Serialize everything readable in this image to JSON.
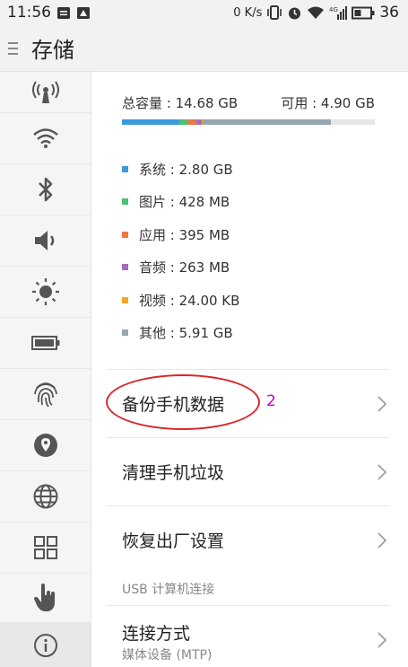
{
  "status_bar": {
    "time": "11:56",
    "network_speed": "0 K/s",
    "signal_label": "4G",
    "battery": "36"
  },
  "header": {
    "title": "存储"
  },
  "sidebar": {
    "items": [
      {
        "icon": "hotspot-icon"
      },
      {
        "icon": "wifi-icon"
      },
      {
        "icon": "bluetooth-icon"
      },
      {
        "icon": "volume-icon"
      },
      {
        "icon": "brightness-icon"
      },
      {
        "icon": "battery-icon"
      },
      {
        "icon": "fingerprint-icon"
      },
      {
        "icon": "location-icon"
      },
      {
        "icon": "globe-icon"
      },
      {
        "icon": "apps-grid-icon"
      },
      {
        "icon": "touch-hand-icon"
      },
      {
        "icon": "info-icon"
      }
    ],
    "selected": "info-icon"
  },
  "storage": {
    "total_label": "总容量 : 14.68 GB",
    "available_label": "可用 : 4.90 GB",
    "segments": [
      {
        "name": "系统",
        "value": "2.80 GB",
        "label": "系统 : 2.80 GB",
        "color": "#3b9ad9",
        "fraction": 0.227
      },
      {
        "name": "图片",
        "value": "428 MB",
        "label": "图片 : 428 MB",
        "color": "#4cc173",
        "fraction": 0.035
      },
      {
        "name": "应用",
        "value": "395 MB",
        "label": "应用 : 395 MB",
        "color": "#f0763f",
        "fraction": 0.032
      },
      {
        "name": "音频",
        "value": "263 MB",
        "label": "音频 : 263 MB",
        "color": "#a66bbf",
        "fraction": 0.021
      },
      {
        "name": "视频",
        "value": "24.00 KB",
        "label": "视频 : 24.00 KB",
        "color": "#f2a922",
        "fraction": 0.004
      },
      {
        "name": "其他",
        "value": "5.91 GB",
        "label": "其他 : 5.91 GB",
        "color": "#95a7b0",
        "fraction": 0.507
      }
    ]
  },
  "actions": {
    "backup": "备份手机数据",
    "clean": "清理手机垃圾",
    "reset": "恢复出厂设置"
  },
  "usb": {
    "section_title": "USB 计算机连接",
    "connection_title": "连接方式",
    "connection_value": "媒体设备 (MTP)"
  },
  "annotation": {
    "number": "2",
    "color": "#cc00cc",
    "circle_color": "#d9262a"
  }
}
